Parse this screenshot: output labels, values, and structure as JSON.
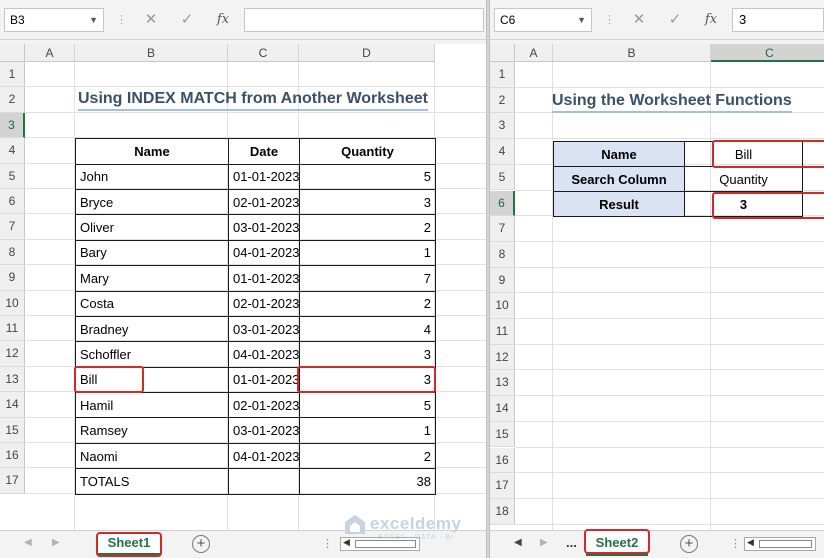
{
  "left": {
    "name_box": "B3",
    "formula_value": "",
    "columns": [
      "A",
      "B",
      "C",
      "D"
    ],
    "selected_row": "3",
    "rows": [
      "1",
      "2",
      "3",
      "4",
      "5",
      "6",
      "7",
      "8",
      "9",
      "10",
      "11",
      "12",
      "13",
      "14",
      "15",
      "16",
      "17"
    ],
    "title": "Using INDEX MATCH from Another Worksheet",
    "table": {
      "headers": [
        "Name",
        "Date",
        "Quantity"
      ],
      "rows": [
        {
          "name": "John",
          "date": "01-01-2023",
          "qty": "5"
        },
        {
          "name": "Bryce",
          "date": "02-01-2023",
          "qty": "3"
        },
        {
          "name": "Oliver",
          "date": "03-01-2023",
          "qty": "2"
        },
        {
          "name": "Bary",
          "date": "04-01-2023",
          "qty": "1"
        },
        {
          "name": "Mary",
          "date": "01-01-2023",
          "qty": "7"
        },
        {
          "name": "Costa",
          "date": "02-01-2023",
          "qty": "2"
        },
        {
          "name": "Bradney",
          "date": "03-01-2023",
          "qty": "4"
        },
        {
          "name": "Schoffler",
          "date": "04-01-2023",
          "qty": "3"
        },
        {
          "name": "Bill",
          "date": "01-01-2023",
          "qty": "3"
        },
        {
          "name": "Hamil",
          "date": "02-01-2023",
          "qty": "5"
        },
        {
          "name": "Ramsey",
          "date": "03-01-2023",
          "qty": "1"
        },
        {
          "name": "Naomi",
          "date": "04-01-2023",
          "qty": "2"
        }
      ],
      "totals": {
        "label": "TOTALS",
        "date": "",
        "qty": "38"
      }
    },
    "sheet_tab": "Sheet1"
  },
  "right": {
    "name_box": "C6",
    "formula_value": "3",
    "columns": [
      "A",
      "B",
      "C"
    ],
    "selected_column": "C",
    "selected_row": "6",
    "rows": [
      "1",
      "2",
      "3",
      "4",
      "5",
      "6",
      "7",
      "8",
      "9",
      "10",
      "11",
      "12",
      "13",
      "14",
      "15",
      "16",
      "17",
      "18"
    ],
    "title": "Using the Worksheet Functions",
    "lookup": {
      "name_label": "Name",
      "name_value": "Bill",
      "column_label": "Search Column",
      "column_value": "Quantity",
      "result_label": "Result",
      "result_value": "3"
    },
    "ellipsis": "...",
    "sheet_tab": "Sheet2"
  },
  "formula_icons": {
    "cancel": "✕",
    "enter": "✓",
    "fx": "fx"
  },
  "watermark": {
    "name": "exceldemy",
    "subtitle": "EXCEL · DATA · BI"
  },
  "colors": {
    "excel_green": "#217346",
    "highlight_red": "#d02a2a",
    "lookup_label_bg": "#dae3f3",
    "title_text": "#3b5168"
  }
}
